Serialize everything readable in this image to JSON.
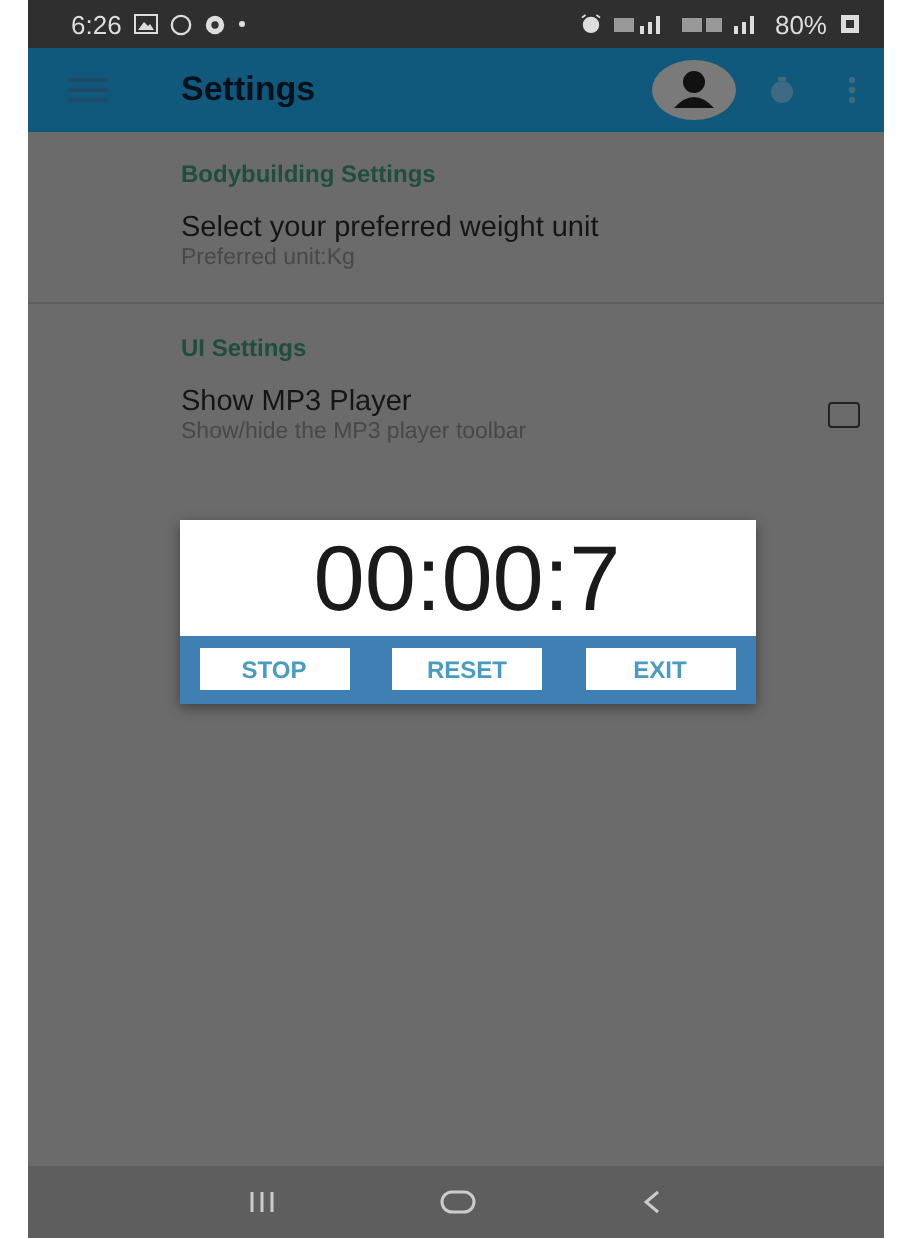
{
  "status_bar": {
    "time": "6:26",
    "battery": "80%"
  },
  "app_bar": {
    "title": "Settings"
  },
  "sections": [
    {
      "header": "Bodybuilding Settings",
      "items": [
        {
          "kind": "text",
          "title": "Select your preferred weight unit",
          "summary": "Preferred unit:Kg"
        }
      ]
    },
    {
      "header": "UI Settings",
      "items": [
        {
          "kind": "checkbox",
          "title": "Show MP3 Player",
          "summary": "Show/hide the MP3 player toolbar",
          "checked": false
        }
      ]
    }
  ],
  "timer_dialog": {
    "time": "00:00:7",
    "buttons": [
      "STOP",
      "RESET",
      "EXIT"
    ]
  }
}
